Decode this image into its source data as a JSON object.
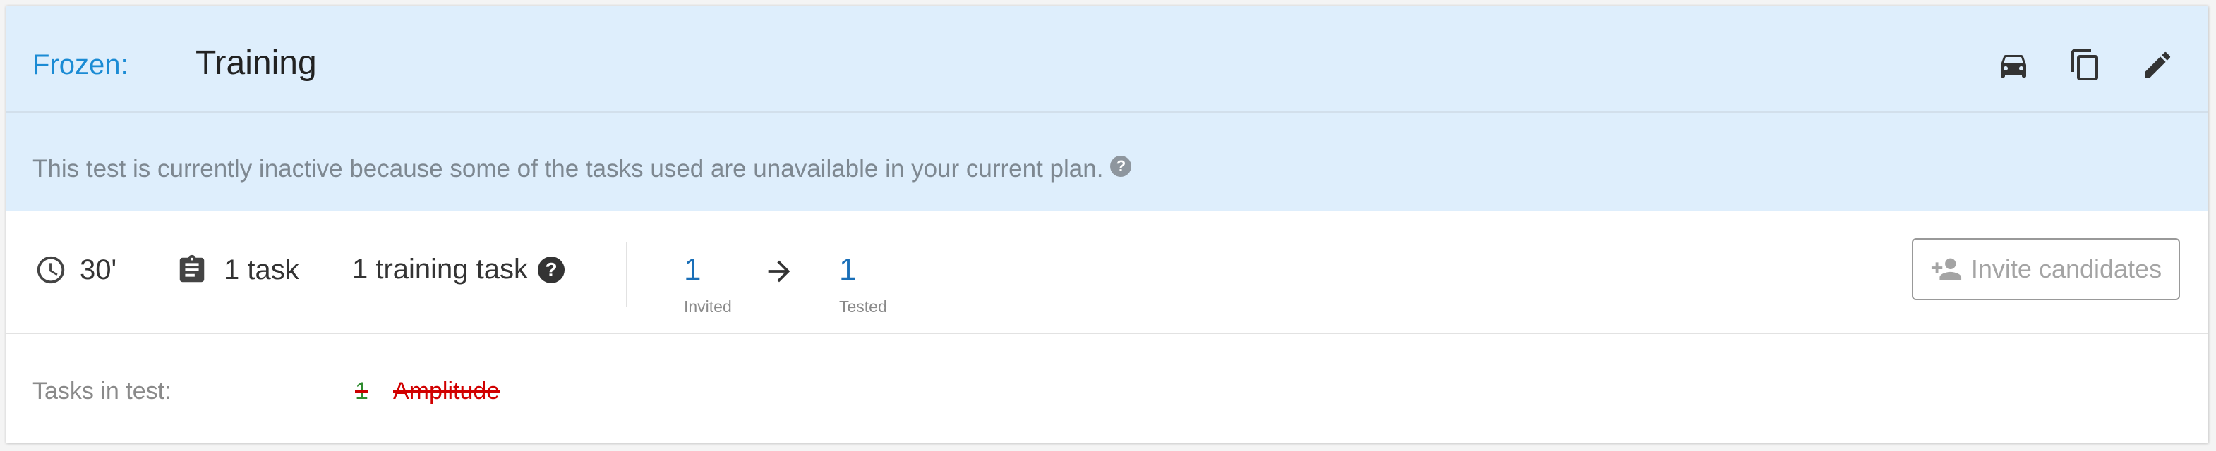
{
  "header": {
    "status_label": "Frozen:",
    "title": "Training",
    "actions": [
      {
        "icon": "car-icon"
      },
      {
        "icon": "copy-icon"
      },
      {
        "icon": "edit-icon"
      }
    ]
  },
  "notice": {
    "text": "This test is currently inactive because some of the tasks used are unavailable in your current plan.",
    "help_glyph": "?"
  },
  "stats": {
    "duration": "30'",
    "tasks": "1 task",
    "training_tasks": "1 training task",
    "help_glyph": "?",
    "invited_value": "1",
    "invited_label": "Invited",
    "tested_value": "1",
    "tested_label": "Tested",
    "invite_button": "Invite candidates"
  },
  "tasks": {
    "label": "Tasks in test:",
    "items": [
      {
        "number": "1",
        "name": "Amplitude"
      }
    ]
  },
  "colors": {
    "header_bg": "#deeefc",
    "status_blue": "#1b8bd4",
    "metric_blue": "#1a6fb8",
    "unavailable_red": "#d10000",
    "number_green": "#2e8b2e"
  }
}
